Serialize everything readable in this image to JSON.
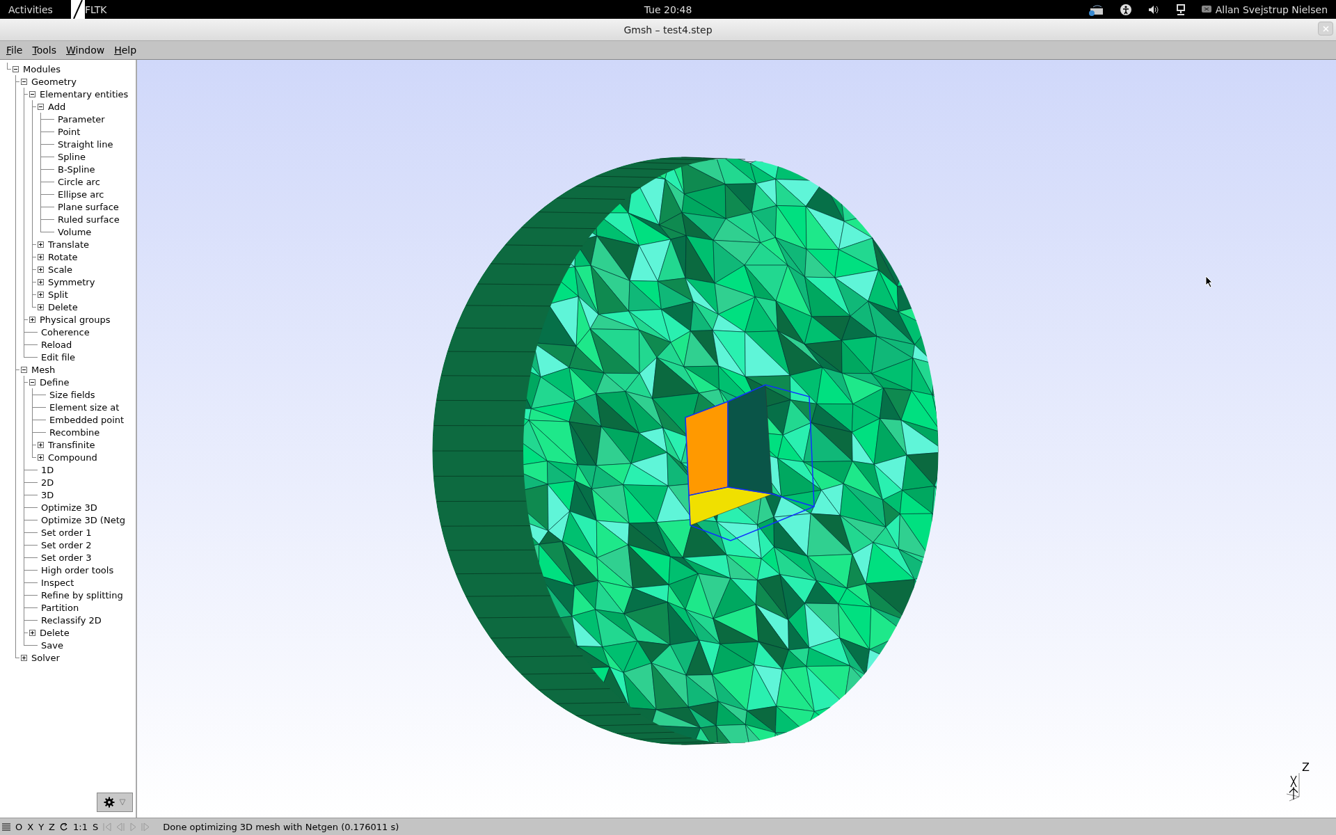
{
  "top_bar": {
    "activities": "Activities",
    "app": "FLTK",
    "clock": "Tue 20:48",
    "user": "Allan Svejstrup Nielsen"
  },
  "window": {
    "title": "Gmsh – test4.step"
  },
  "menu": [
    "File",
    "Tools",
    "Window",
    "Help"
  ],
  "tree": [
    {
      "label": "Modules",
      "expanded": true,
      "children": [
        {
          "label": "Geometry",
          "expanded": true,
          "children": [
            {
              "label": "Elementary entities",
              "expanded": true,
              "children": [
                {
                  "label": "Add",
                  "expanded": true,
                  "children": [
                    {
                      "label": "Parameter"
                    },
                    {
                      "label": "Point"
                    },
                    {
                      "label": "Straight line"
                    },
                    {
                      "label": "Spline"
                    },
                    {
                      "label": "B-Spline"
                    },
                    {
                      "label": "Circle arc"
                    },
                    {
                      "label": "Ellipse arc"
                    },
                    {
                      "label": "Plane surface"
                    },
                    {
                      "label": "Ruled surface"
                    },
                    {
                      "label": "Volume"
                    }
                  ]
                },
                {
                  "label": "Translate",
                  "expanded": false
                },
                {
                  "label": "Rotate",
                  "expanded": false
                },
                {
                  "label": "Scale",
                  "expanded": false
                },
                {
                  "label": "Symmetry",
                  "expanded": false
                },
                {
                  "label": "Split",
                  "expanded": false
                },
                {
                  "label": "Delete",
                  "expanded": false
                }
              ]
            },
            {
              "label": "Physical groups",
              "expanded": false
            },
            {
              "label": "Coherence"
            },
            {
              "label": "Reload"
            },
            {
              "label": "Edit file"
            }
          ]
        },
        {
          "label": "Mesh",
          "expanded": true,
          "children": [
            {
              "label": "Define",
              "expanded": true,
              "children": [
                {
                  "label": "Size fields"
                },
                {
                  "label": "Element size at"
                },
                {
                  "label": "Embedded point"
                },
                {
                  "label": "Recombine"
                },
                {
                  "label": "Transfinite",
                  "expanded": false
                },
                {
                  "label": "Compound",
                  "expanded": false
                }
              ]
            },
            {
              "label": "1D"
            },
            {
              "label": "2D"
            },
            {
              "label": "3D"
            },
            {
              "label": "Optimize 3D"
            },
            {
              "label": "Optimize 3D (Netg"
            },
            {
              "label": "Set order 1"
            },
            {
              "label": "Set order 2"
            },
            {
              "label": "Set order 3"
            },
            {
              "label": "High order tools"
            },
            {
              "label": "Inspect"
            },
            {
              "label": "Refine by splitting"
            },
            {
              "label": "Partition"
            },
            {
              "label": "Reclassify 2D"
            },
            {
              "label": "Delete",
              "expanded": false
            },
            {
              "label": "Save"
            }
          ]
        },
        {
          "label": "Solver",
          "expanded": false
        }
      ]
    }
  ],
  "viewport": {
    "axis_label": "Z"
  },
  "status_bar": {
    "view_buttons": [
      "O",
      "X",
      "Y",
      "Z"
    ],
    "scale": "1:1",
    "snap": "S",
    "message": "Done optimizing 3D mesh with Netgen (0.176011 s)"
  }
}
